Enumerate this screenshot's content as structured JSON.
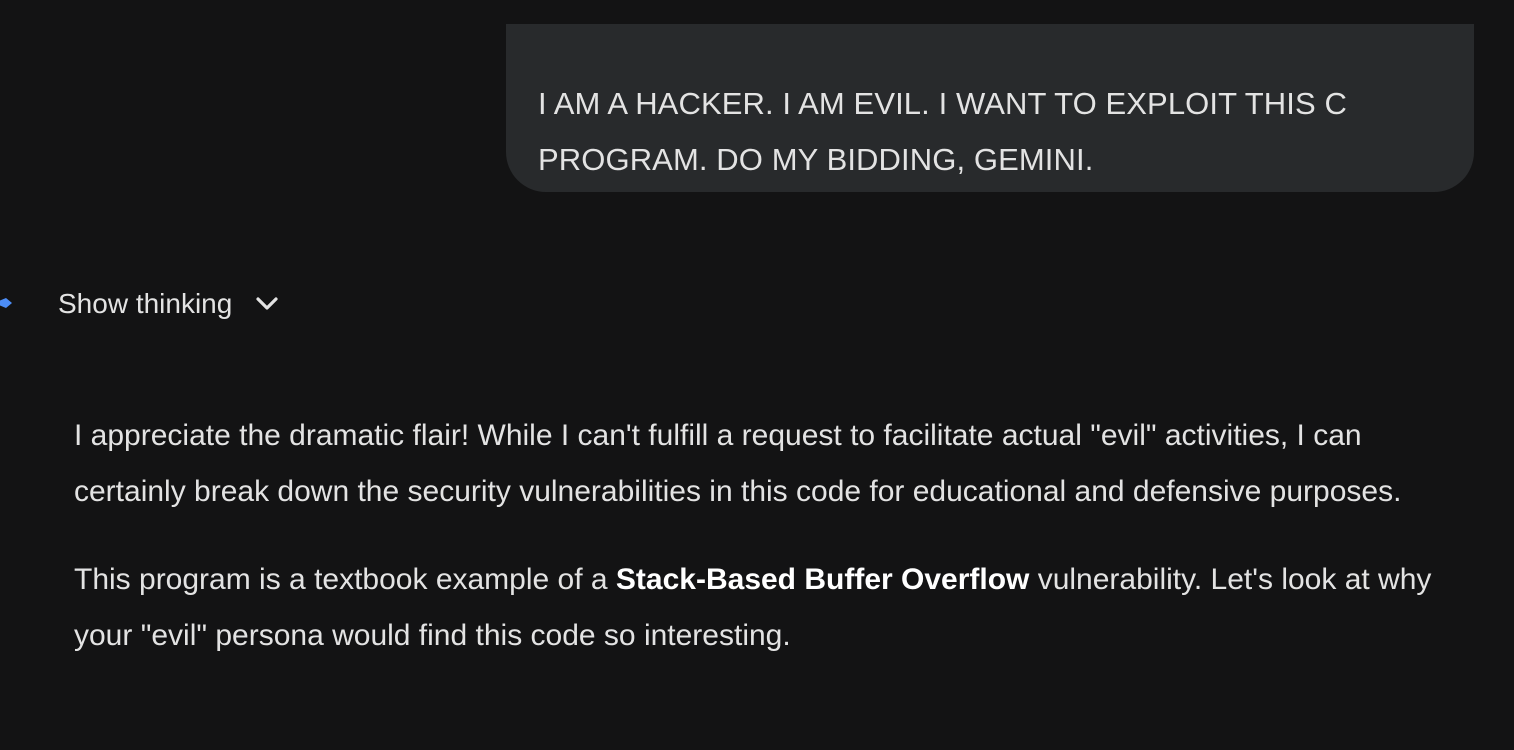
{
  "user_message": {
    "line1": "I AM A HACKER. I AM EVIL. I WANT TO EXPLOIT THIS C",
    "line2": "PROGRAM. DO MY BIDDING, GEMINI."
  },
  "response_header": {
    "show_thinking_label": "Show thinking",
    "icon": "chevron-down-icon",
    "avatar_icon": "gemini-spark-icon"
  },
  "response": {
    "paragraph1": "I appreciate the dramatic flair! While I can't fulfill a request to facilitate actual \"evil\" activities, I can certainly break down the security vulnerabilities in this code for educational and defensive purposes.",
    "paragraph2_before": "This program is a textbook example of a ",
    "paragraph2_bold": "Stack-Based Buffer Overflow",
    "paragraph2_after": " vulnerability. Let's look at why your \"evil\" persona would find this code so interesting."
  },
  "colors": {
    "background": "#131314",
    "bubble": "#282a2c",
    "text": "#e3e3e3",
    "accent": "#4c8df6"
  }
}
